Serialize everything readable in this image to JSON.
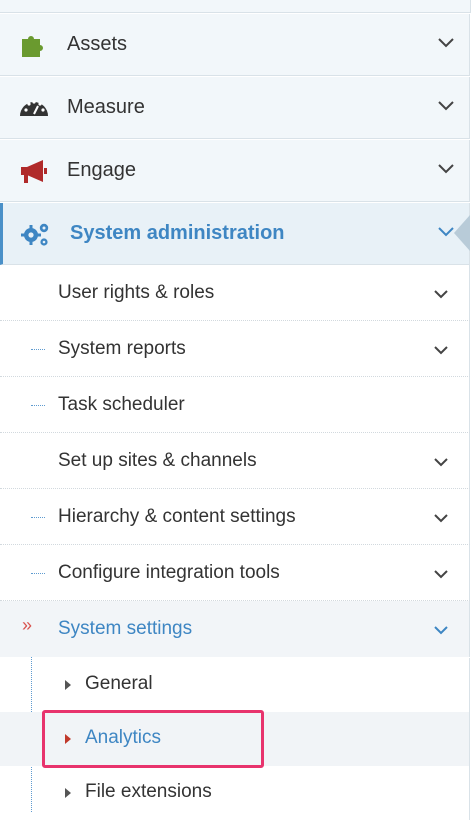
{
  "menu": {
    "main_items": [
      {
        "label": "Assets",
        "icon": "puzzle-icon",
        "icon_color": "#6a9a2f"
      },
      {
        "label": "Measure",
        "icon": "dashboard-gauge-icon",
        "icon_color": "#333333"
      },
      {
        "label": "Engage",
        "icon": "megaphone-icon",
        "icon_color": "#b02a2a"
      },
      {
        "label": "System administration",
        "icon": "gears-icon",
        "icon_color": "#3e86c3",
        "active": true
      }
    ],
    "sub_items": [
      {
        "label": "User rights & roles",
        "expandable": true
      },
      {
        "label": "System reports",
        "expandable": true
      },
      {
        "label": "Task scheduler",
        "expandable": false
      },
      {
        "label": "Set up sites & channels",
        "expandable": true
      },
      {
        "label": "Hierarchy & content settings",
        "expandable": true
      },
      {
        "label": "Configure integration tools",
        "expandable": true
      },
      {
        "label": "System settings",
        "expandable": true,
        "selected": true
      }
    ],
    "leaf_items": [
      {
        "label": "General"
      },
      {
        "label": "Analytics",
        "highlighted": true
      },
      {
        "label": "File extensions"
      }
    ],
    "selected_marker": "»"
  },
  "colors": {
    "accent_blue": "#3e86c3",
    "highlight_pink": "#e8336d"
  }
}
